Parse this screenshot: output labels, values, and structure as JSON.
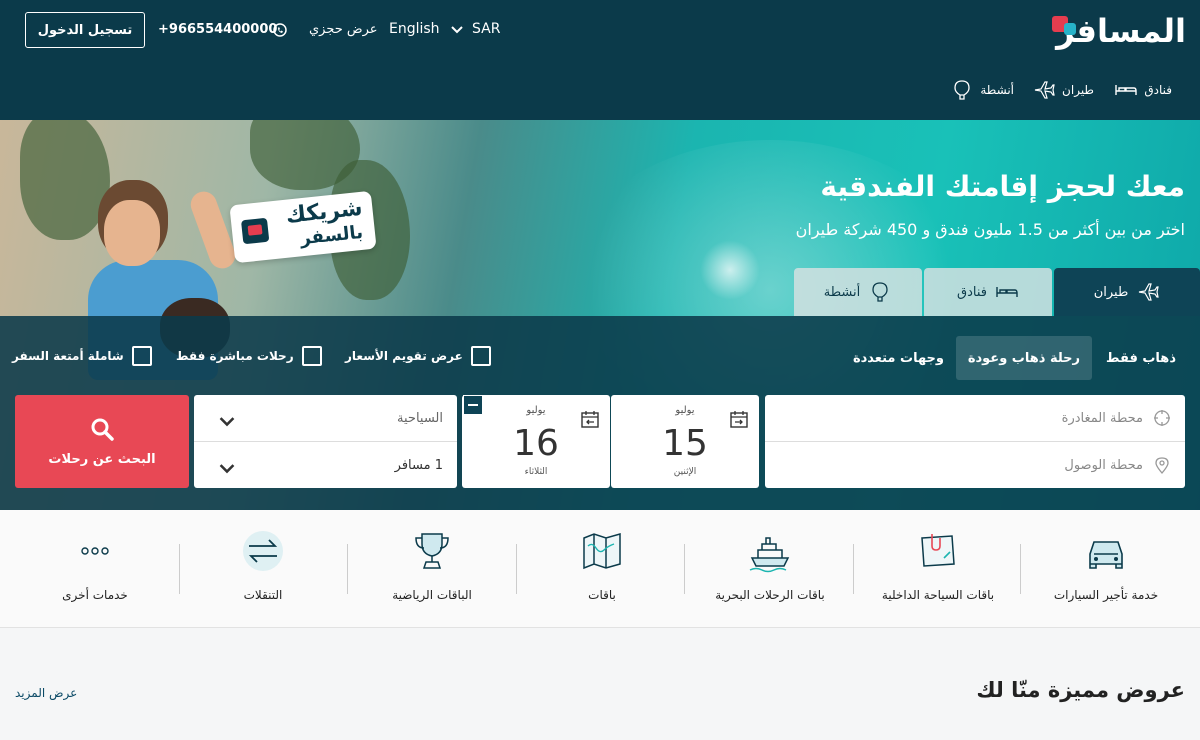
{
  "brand": {
    "name": "المسافر"
  },
  "header": {
    "login_label": "تسجيل الدخول",
    "phone": "+966554400000",
    "my_booking": "عرض حجزي",
    "language": "English",
    "currency": "SAR"
  },
  "nav": [
    {
      "label": "فنادق",
      "icon": "bed-icon"
    },
    {
      "label": "طيران",
      "icon": "plane-icon"
    },
    {
      "label": "أنشطة",
      "icon": "balloon-icon"
    }
  ],
  "hero": {
    "title": "معك لحجز إقامتك الفندقية",
    "subtitle": "اختر من بين أكثر من 1.5 مليون فندق و 450 شركة طيران",
    "tag_line1": "شريكك",
    "tag_line2": "بالسفر"
  },
  "tabs": [
    {
      "label": "طيران",
      "icon": "plane-icon",
      "active": true
    },
    {
      "label": "فنادق",
      "icon": "bed-icon",
      "active": false
    },
    {
      "label": "أنشطة",
      "icon": "balloon-icon",
      "active": false
    }
  ],
  "search": {
    "trip_types": [
      "ذهاب فقط",
      "رحلة ذهاب وعودة",
      "وجهات متعددة"
    ],
    "active_trip_type": "رحلة ذهاب وعودة",
    "checkboxes": [
      "عرض تقويم الأسعار",
      "رحلات مباشرة فقط",
      "شاملة أمتعة السفر"
    ],
    "departure_placeholder": "محطة المغادرة",
    "arrival_placeholder": "محطة الوصول",
    "depart_date": {
      "month": "يوليو",
      "day": "15",
      "weekday": "الإثنين"
    },
    "return_date": {
      "month": "يوليو",
      "day": "16",
      "weekday": "الثلاثاء"
    },
    "cabin_class": "السياحية",
    "passengers": "1 مسافر",
    "search_button": "البحث عن رحلات"
  },
  "services": [
    {
      "label": "خدمة تأجير السيارات",
      "icon": "car-icon"
    },
    {
      "label": "باقات السياحة الداخلية",
      "icon": "map-pin-paper-icon"
    },
    {
      "label": "باقات الرحلات البحرية",
      "icon": "cruise-ship-icon"
    },
    {
      "label": "باقات",
      "icon": "world-map-icon"
    },
    {
      "label": "الباقات الرياضية",
      "icon": "trophy-icon"
    },
    {
      "label": "التنقلات",
      "icon": "transfer-arrows-icon"
    },
    {
      "label": "خدمات أخرى",
      "icon": "more-dots-icon"
    }
  ],
  "offers": {
    "title": "عروض مميزة منّا لك",
    "more_link": "عرض المزيد"
  },
  "colors": {
    "header_bg": "#0b3a4a",
    "accent_red": "#e84855",
    "teal": "#1bb5b0"
  }
}
